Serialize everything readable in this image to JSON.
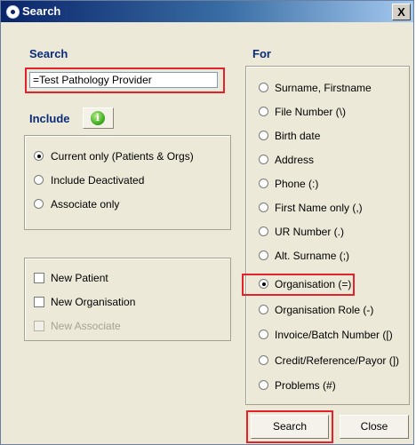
{
  "window": {
    "title": "Search",
    "close_label": "X"
  },
  "search": {
    "heading": "Search",
    "value": "=Test Pathology Provider",
    "placeholder": ""
  },
  "include": {
    "heading": "Include",
    "info_icon": "i",
    "options": [
      {
        "label": "Current only (Patients & Orgs)",
        "selected": true
      },
      {
        "label": "Include Deactivated",
        "selected": false
      },
      {
        "label": "Associate only",
        "selected": false
      }
    ]
  },
  "new_items": [
    {
      "label": "New Patient",
      "checked": false,
      "disabled": false
    },
    {
      "label": "New Organisation",
      "checked": false,
      "disabled": false
    },
    {
      "label": "New Associate",
      "checked": false,
      "disabled": true
    }
  ],
  "for": {
    "heading": "For",
    "options": [
      {
        "label": "Surname, Firstname",
        "selected": false
      },
      {
        "label": "File Number (\\)",
        "selected": false
      },
      {
        "label": "Birth date",
        "selected": false
      },
      {
        "label": "Address",
        "selected": false
      },
      {
        "label": "Phone (:)",
        "selected": false
      },
      {
        "label": "First Name only (,)",
        "selected": false
      },
      {
        "label": "UR Number (.)",
        "selected": false
      },
      {
        "label": "Alt. Surname (;)",
        "selected": false
      },
      {
        "label": "Organisation (=)",
        "selected": true
      },
      {
        "label": "Organisation Role (-)",
        "selected": false
      },
      {
        "label": "Invoice/Batch Number ([)",
        "selected": false
      },
      {
        "label": "Credit/Reference/Payor (])",
        "selected": false
      },
      {
        "label": "Problems (#)",
        "selected": false
      }
    ]
  },
  "buttons": {
    "search": "Search",
    "close": "Close"
  },
  "colors": {
    "title_bar": "#0a246a",
    "heading_text": "#0a2c7a",
    "highlight": "#e3222b",
    "dialog_bg": "#ece9d8"
  }
}
